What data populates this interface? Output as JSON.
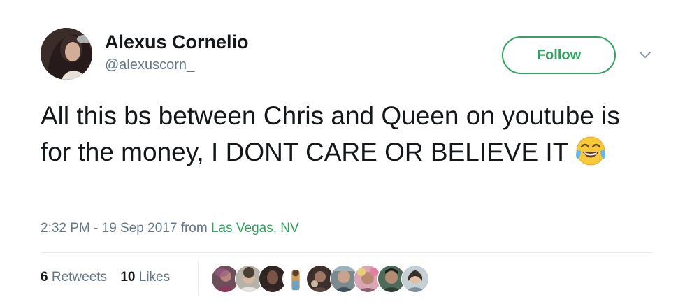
{
  "user": {
    "display_name": "Alexus Cornelio",
    "handle": "@alexuscorn_"
  },
  "follow_label": "Follow",
  "tweet": {
    "text": "All this bs between Chris and Queen on youtube is for the money, I DONT CARE OR BELIEVE IT",
    "emoji": "face-with-tears-of-joy"
  },
  "meta": {
    "timestamp": "2:32 PM - 19 Sep 2017",
    "from_label": "from",
    "location": "Las Vegas, NV"
  },
  "stats": {
    "retweets_count": "6",
    "retweets_label": "Retweets",
    "likes_count": "10",
    "likes_label": "Likes"
  },
  "colors": {
    "accent": "#2fa35f",
    "secondary_text": "#657786",
    "primary_text": "#14171a",
    "divider": "#e6ecf0"
  },
  "liker_avatars": [
    "liker-avatar-1",
    "liker-avatar-2",
    "liker-avatar-3",
    "liker-avatar-4",
    "liker-avatar-5",
    "liker-avatar-6",
    "liker-avatar-7",
    "liker-avatar-8",
    "liker-avatar-9"
  ]
}
